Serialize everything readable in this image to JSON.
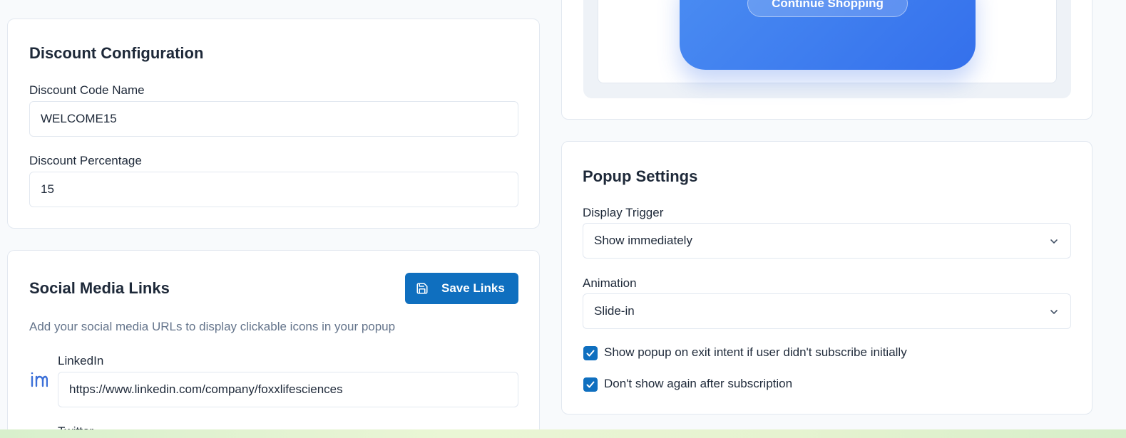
{
  "discount": {
    "title": "Discount Configuration",
    "code_label": "Discount Code Name",
    "code_value": "WELCOME15",
    "percent_label": "Discount Percentage",
    "percent_value": "15"
  },
  "social": {
    "title": "Social Media Links",
    "save_label": "Save Links",
    "help": "Add your social media URLs to display clickable icons in your popup",
    "linkedin_label": "LinkedIn",
    "linkedin_value": "https://www.linkedin.com/company/foxxlifesciences",
    "twitter_label": "Twitter"
  },
  "preview": {
    "continue_label": "Continue Shopping"
  },
  "popup_settings": {
    "title": "Popup Settings",
    "trigger_label": "Display Trigger",
    "trigger_value": "Show immediately",
    "animation_label": "Animation",
    "animation_value": "Slide-in",
    "exit_intent_label": "Show popup on exit intent if user didn't subscribe initially",
    "exit_intent_checked": true,
    "no_repeat_label": "Don't show again after subscription",
    "no_repeat_checked": true
  },
  "icons": {
    "save": "save-icon",
    "linkedin": "linkedin-icon",
    "chevron": "chevron-down-icon",
    "check": "check-icon"
  },
  "colors": {
    "accent": "#0f6fbf",
    "preview_blue": "#3f7ff0"
  }
}
